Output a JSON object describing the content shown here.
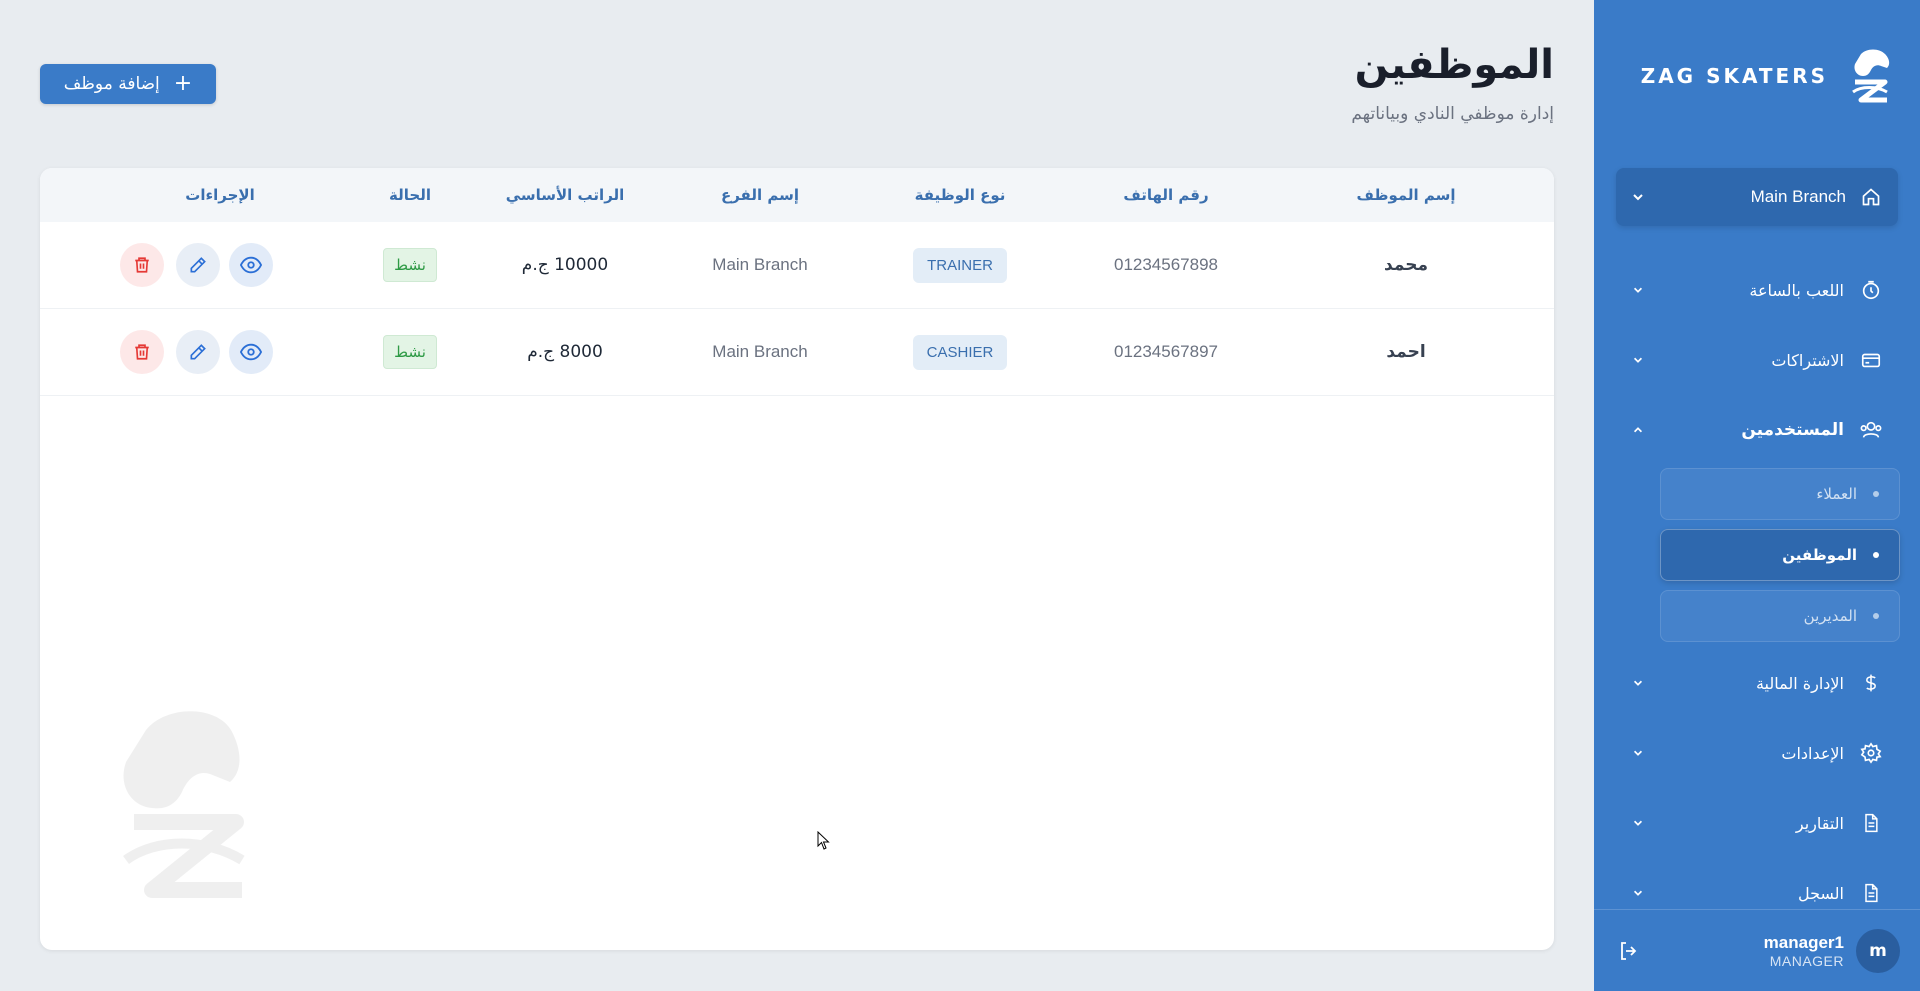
{
  "sidebar": {
    "brand": "ZAG SKATERS",
    "branch": "Main Branch",
    "items": [
      {
        "label": "اللعب بالساعة",
        "icon": "stopwatch-icon"
      },
      {
        "label": "الاشتراكات",
        "icon": "card-icon"
      },
      {
        "label": "المستخدمين",
        "icon": "users-icon",
        "open": true
      },
      {
        "label": "الإدارة المالية",
        "icon": "dollar-icon"
      },
      {
        "label": "الإعدادات",
        "icon": "gear-icon"
      },
      {
        "label": "التقارير",
        "icon": "report-icon"
      },
      {
        "label": "السجل",
        "icon": "log-icon"
      }
    ],
    "subitems": [
      {
        "label": "العملاء"
      },
      {
        "label": "الموظفين",
        "active": true
      },
      {
        "label": "المديرين"
      }
    ],
    "user": {
      "name": "manager1",
      "role": "MANAGER",
      "avatar": "m"
    }
  },
  "page": {
    "title": "الموظفين",
    "subtitle": "إدارة موظفي النادي وبياناتهم",
    "add_button": "إضافة موظف"
  },
  "table": {
    "headers": {
      "name": "إسم الموظف",
      "phone": "رقم الهاتف",
      "role": "نوع الوظيفة",
      "branch": "إسم الفرع",
      "salary": "الراتب الأساسي",
      "status": "الحالة",
      "actions": "الإجراءات"
    },
    "rows": [
      {
        "name": "محمد",
        "phone": "01234567898",
        "role": "TRAINER",
        "branch": "Main Branch",
        "salary": "10000 ج.م",
        "status": "نشط"
      },
      {
        "name": "احمد",
        "phone": "01234567897",
        "role": "CASHIER",
        "branch": "Main Branch",
        "salary": "8000 ج.م",
        "status": "نشط"
      }
    ]
  },
  "colors": {
    "primary": "#3a7bc8",
    "sidebar_dark": "#2e68ae",
    "header_text": "#3a6fae",
    "status_green": "#2e9a45",
    "danger": "#e53935"
  }
}
